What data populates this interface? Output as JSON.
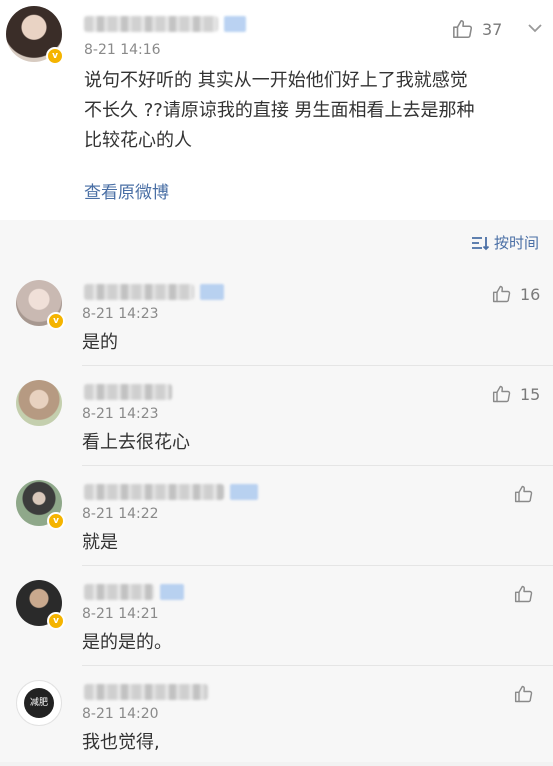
{
  "main_post": {
    "time": "8-21 14:16",
    "likes": "37",
    "text_lines": [
      "说句不好听的 其实从一开始他们好上了我就感觉",
      "不长久 ??请原谅我的直接 男生面相看上去是那种",
      "比较花心的人"
    ],
    "view_original": "查看原微博"
  },
  "sort": {
    "label": "按时间"
  },
  "badge_glyph": "v",
  "comments": [
    {
      "time": "8-21 14:23",
      "text": "是的",
      "likes": "16"
    },
    {
      "time": "8-21 14:23",
      "text": "看上去很花心",
      "likes": "15"
    },
    {
      "time": "8-21 14:22",
      "text": "就是",
      "likes": ""
    },
    {
      "time": "8-21 14:21",
      "text": "是的是的。",
      "likes": ""
    },
    {
      "time": "8-21 14:20",
      "text": "我也觉得,",
      "likes": "",
      "avatar_text": "减肥"
    }
  ],
  "icons": {
    "like": "thumbs-up-icon",
    "sort": "sort-lines-icon",
    "verified": "verified-badge-icon"
  },
  "colors": {
    "link": "#4a6fa5",
    "badge": "#f5b400",
    "time": "#8a8a8a"
  }
}
